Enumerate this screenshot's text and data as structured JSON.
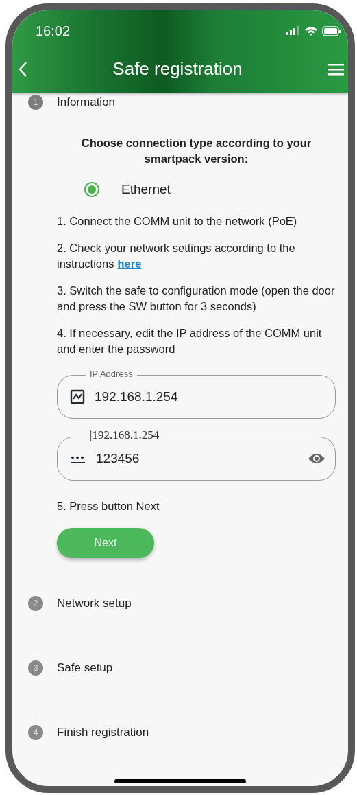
{
  "status_bar": {
    "time": "16:02"
  },
  "header": {
    "title": "Safe registration"
  },
  "steps": [
    {
      "number": "1",
      "label": "Information",
      "expanded": true
    },
    {
      "number": "2",
      "label": "Network setup",
      "expanded": false
    },
    {
      "number": "3",
      "label": "Safe setup",
      "expanded": false
    },
    {
      "number": "4",
      "label": "Finish registration",
      "expanded": false
    }
  ],
  "information": {
    "heading": "Choose connection type according to your smartpack version:",
    "options": [
      {
        "label": "Ethernet",
        "selected": true
      }
    ],
    "instructions": [
      {
        "text": "1. Connect the COMM unit to the network (PoE)"
      },
      {
        "text": "2. Check your network settings according to the instructions",
        "link": "here"
      },
      {
        "text": "3. Switch the safe to configuration mode (open the door and press the SW button for 3 seconds)"
      },
      {
        "text": "4. If necessary, edit the IP address of the COMM unit and enter the password"
      }
    ],
    "fields": [
      {
        "kind": "address",
        "label": "IP Address",
        "value": "192.168.1.254"
      },
      {
        "kind": "password",
        "label": "|192.168.1.254",
        "value": "123456"
      }
    ],
    "final_instruction": "5. Press button Next",
    "button": "Next"
  }
}
